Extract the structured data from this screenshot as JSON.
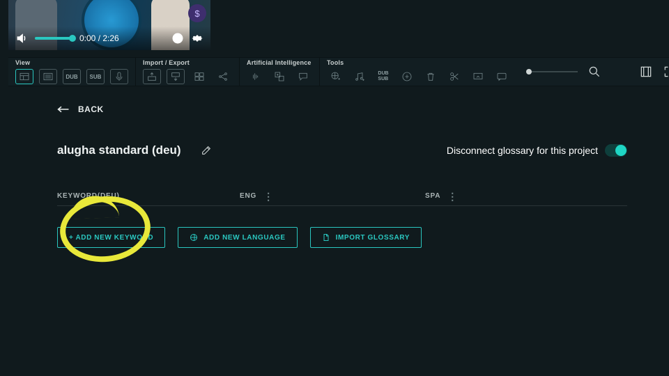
{
  "video": {
    "time": "0:00 / 2:26",
    "coin_glyph": "$"
  },
  "toolbar": {
    "groups": {
      "view": "View",
      "import_export": "Import / Export",
      "ai": "Artificial Intelligence",
      "tools": "Tools"
    },
    "view_icons": [
      "layout",
      "list",
      "DUB",
      "SUB",
      "mic"
    ],
    "ie_icons": [
      "sub-up",
      "sub-down",
      "panels",
      "share"
    ],
    "ai_icons": [
      "wave",
      "translate",
      "speech"
    ],
    "tools_icons": [
      "globe-plus",
      "music-plus",
      "dub-sub",
      "plus-circle",
      "trash",
      "cut",
      "screen",
      "chat"
    ]
  },
  "content": {
    "back": "BACK",
    "title": "alugha standard (deu)",
    "toggle_label": "Disconnect glossary for this project",
    "columns": {
      "keyword": "KEYWORD(DEU)",
      "lang1": "ENG",
      "lang2": "SPA"
    },
    "buttons": {
      "add_keyword": "+ ADD NEW KEYWORD",
      "add_language": "ADD NEW LANGUAGE",
      "import": "IMPORT GLOSSARY"
    }
  },
  "colors": {
    "accent": "#2ac7c0",
    "annotation": "#e8e83a"
  }
}
